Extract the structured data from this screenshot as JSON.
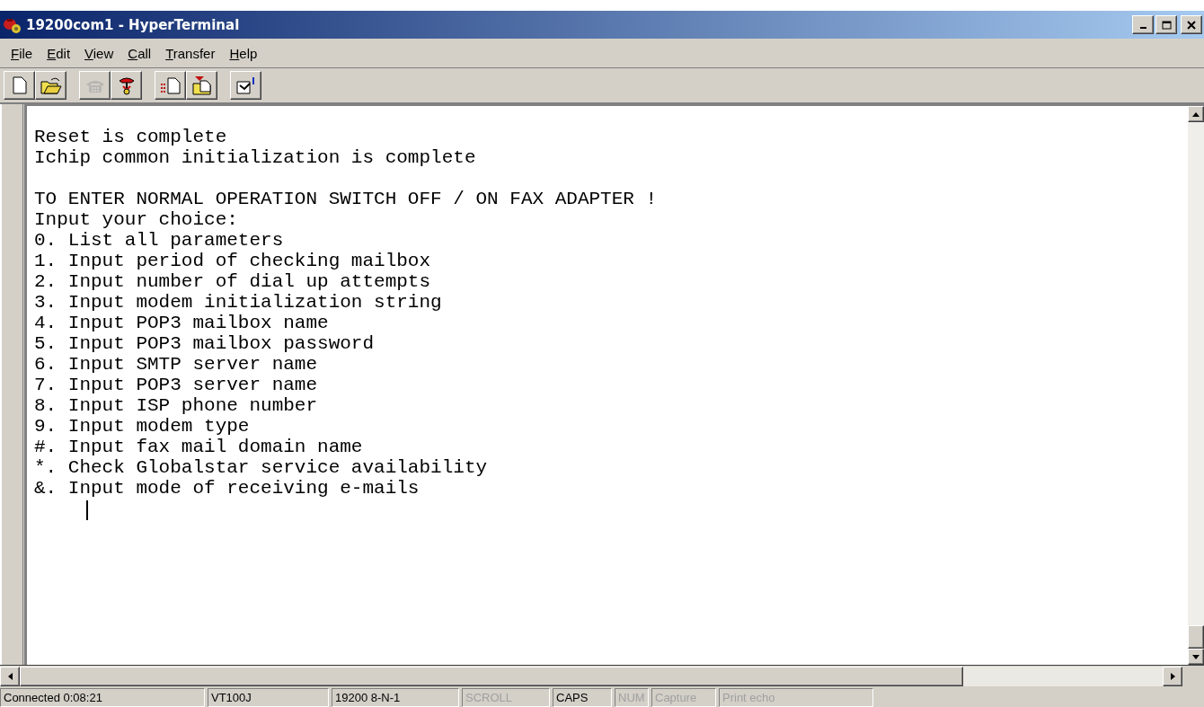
{
  "window": {
    "title": "19200com1 - HyperTerminal",
    "controls": [
      {
        "kind": "minimize"
      },
      {
        "kind": "maximize"
      },
      {
        "kind": "close"
      }
    ]
  },
  "menu": [
    "File",
    "Edit",
    "View",
    "Call",
    "Transfer",
    "Help"
  ],
  "toolbar": [
    {
      "kind": "new",
      "disabled": false
    },
    {
      "kind": "open",
      "disabled": false
    },
    {
      "kind": "call",
      "disabled": true
    },
    {
      "kind": "disconnect",
      "disabled": false
    },
    {
      "kind": "send",
      "disabled": false
    },
    {
      "kind": "receive",
      "disabled": false
    },
    {
      "kind": "properties",
      "disabled": false
    }
  ],
  "terminal": {
    "paragraphs": [
      [
        "Reset is complete",
        "Ichip common initialization is complete"
      ],
      [
        "TO ENTER NORMAL OPERATION SWITCH OFF / ON FAX ADAPTER !",
        "Input your choice:",
        "0. List all parameters",
        "1. Input period of checking mailbox",
        "2. Input number of dial up attempts",
        "3. Input modem initialization string",
        "4. Input POP3 mailbox name",
        "5. Input POP3 mailbox password",
        "6. Input SMTP server name",
        "7. Input POP3 server name",
        "8. Input ISP phone number",
        "9. Input modem type",
        "#. Input fax mail domain name",
        "*. Check Globalstar service availability",
        "&. Input mode of receiving e-mails"
      ]
    ]
  },
  "status_bar": [
    {
      "text": "Connected 0:08:21",
      "on": true
    },
    {
      "text": "VT100J",
      "on": true
    },
    {
      "text": "19200 8-N-1",
      "on": true
    },
    {
      "text": "SCROLL",
      "on": false
    },
    {
      "text": "CAPS",
      "on": true
    },
    {
      "text": "NUM",
      "on": false
    },
    {
      "text": "Capture",
      "on": false
    },
    {
      "text": "Print echo",
      "on": false
    }
  ]
}
